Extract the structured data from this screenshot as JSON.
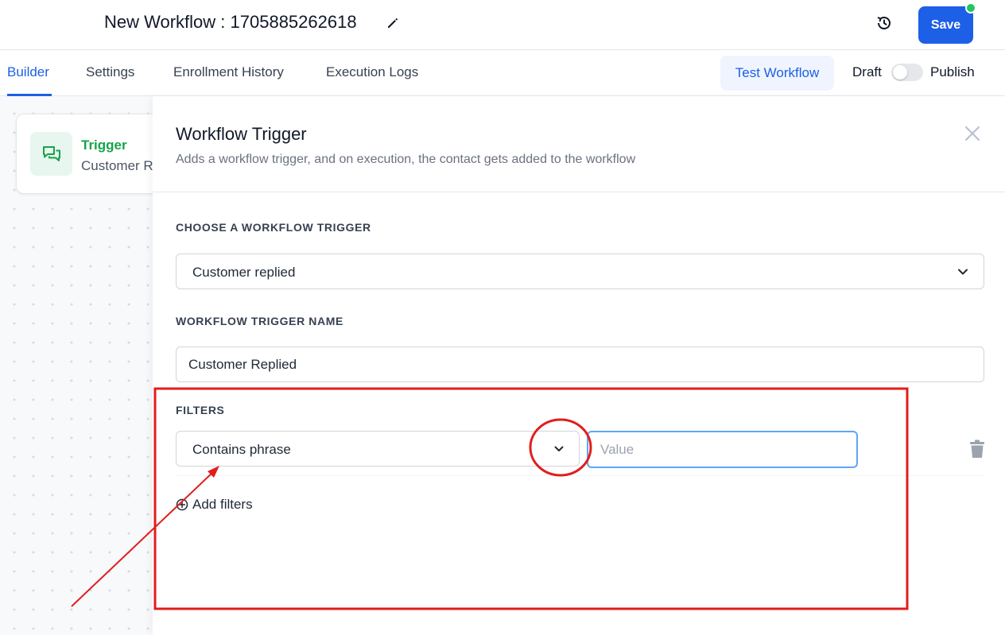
{
  "header": {
    "workflow_title": "New Workflow : 1705885262618",
    "save_label": "Save",
    "status_dot_color": "#22c55e"
  },
  "tabs": [
    {
      "label": "Builder",
      "active": true
    },
    {
      "label": "Settings",
      "active": false
    },
    {
      "label": "Enrollment History",
      "active": false
    },
    {
      "label": "Execution Logs",
      "active": false
    }
  ],
  "actions": {
    "test_workflow_label": "Test Workflow",
    "draft_label": "Draft",
    "publish_label": "Publish",
    "publish_toggle_on": false
  },
  "canvas": {
    "trigger_node": {
      "title": "Trigger",
      "subtitle": "Customer Replied",
      "icon": "chat-bubbles-icon"
    }
  },
  "panel": {
    "title": "Workflow Trigger",
    "description": "Adds a workflow trigger, and on execution, the contact gets added to the workflow",
    "choose_trigger_label": "CHOOSE A WORKFLOW TRIGGER",
    "selected_trigger": "Customer replied",
    "trigger_name_label": "WORKFLOW TRIGGER NAME",
    "trigger_name_value": "Customer Replied",
    "filters_label": "FILTERS",
    "filter_condition": "Contains phrase",
    "filter_value_placeholder": "Value",
    "add_filters_label": "Add filters"
  },
  "colors": {
    "accent": "#1d5fe6",
    "trigger_green": "#16a34a",
    "annotation_red": "#e11d1d"
  }
}
